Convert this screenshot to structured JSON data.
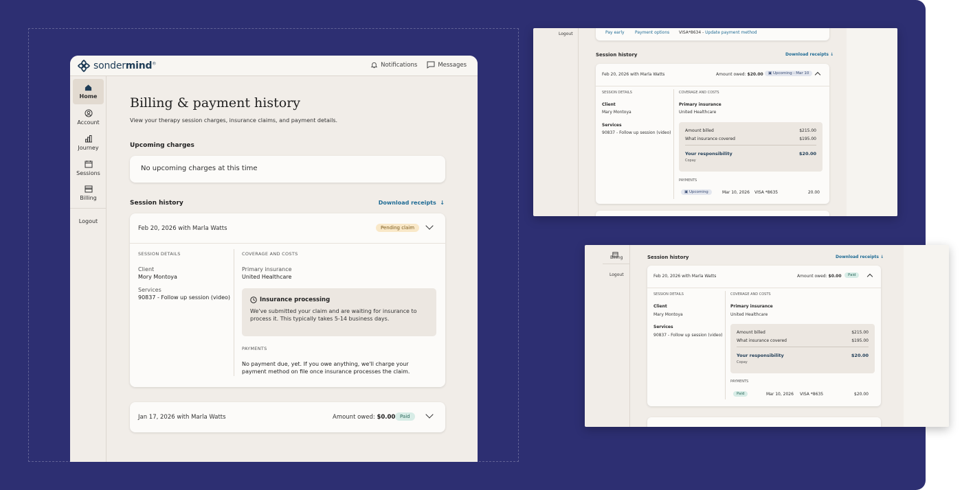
{
  "brand": {
    "name_light": "sonder",
    "name_bold": "mind",
    "mark": "®"
  },
  "topnav": {
    "notifications": "Notifications",
    "messages": "Messages"
  },
  "sidebar": {
    "items": [
      {
        "label": "Home",
        "icon": "home-icon"
      },
      {
        "label": "Account",
        "icon": "account-icon"
      },
      {
        "label": "Journey",
        "icon": "chart-icon"
      },
      {
        "label": "Sessions",
        "icon": "calendar-icon"
      },
      {
        "label": "Billing",
        "icon": "card-icon"
      }
    ],
    "logout": "Logout"
  },
  "page": {
    "title": "Billing & payment history",
    "subtitle": "View your therapy session charges, insurance claims, and payment details.",
    "upcoming_heading": "Upcoming charges",
    "upcoming_empty": "No upcoming charges at this time",
    "history_heading": "Session history",
    "download_receipts": "Download receipts"
  },
  "sessions": [
    {
      "title": "Feb 20, 2026 with Marla Watts",
      "badge": "Pending claim",
      "session_details_label": "SESSION DETAILS",
      "client_label": "Client",
      "client": "Mory Montoya",
      "services_label": "Services",
      "services": "90837 - Follow up session (video)",
      "coverage_label": "COVERAGE AND COSTS",
      "insurance_label": "Primary insurance",
      "insurance": "United Healthcare",
      "info_title": "Insurance processing",
      "info_text": "We've submitted your claim and are waiting for insurance to process it. This typically takes 5-14 business days.",
      "payments_label": "PAYMENTS",
      "payments_text": "No payment due, yet. If you owe anything, we'll charge your payment method on file once insurance processes the claim."
    },
    {
      "title": "Jan 17, 2026 with Marla Watts",
      "owed_label": "Amount owed:",
      "owed": "$0.00",
      "badge": "Paid"
    }
  ],
  "panel1": {
    "logout": "Logout",
    "pay_early": "Pay early",
    "payment_options": "Payment options",
    "visa_prefix": "VISA*8634 - ",
    "update_method": "Update payment method",
    "history_heading": "Session history",
    "download_receipts": "Download receipts",
    "row_title": "Feb 20, 2026 with Marla Watts",
    "owed_label": "Amount owed:",
    "owed": "$20.00",
    "badge": "Upcoming - Mar 10",
    "session_details_label": "SESSION DETAILS",
    "client_label": "Client",
    "client": "Mary Montoya",
    "services_label": "Services",
    "services": "90837 - Follow up session (video)",
    "coverage_label": "COVERAGE AND COSTS",
    "insurance_label": "Primary insurance",
    "insurance": "United Healthcare",
    "amount_billed_label": "Amount billed",
    "amount_billed": "$215.00",
    "covered_label": "What insurance covered",
    "covered": "$195.00",
    "responsibility_label": "Your responsibility",
    "responsibility": "$20.00",
    "copay": "Copay",
    "payments_label": "PAYMENTS",
    "pay_status": "Upcoming",
    "pay_date": "Mar 10, 2026",
    "pay_card": "VISA *8635",
    "pay_amount": "20.00"
  },
  "panel2": {
    "billing": "Billing",
    "logout": "Logout",
    "history_heading": "Session history",
    "download_receipts": "Download receipts",
    "row_title": "Feb 20, 2026 with Marla Watts",
    "owed_label": "Amount owed:",
    "owed": "$0.00",
    "badge": "Paid",
    "session_details_label": "SESSION DETAILS",
    "client_label": "Client",
    "client": "Mary Montoya",
    "services_label": "Services",
    "services": "90837 - Follow up session (video)",
    "coverage_label": "COVERAGE AND COSTS",
    "insurance_label": "Primary insurance",
    "insurance": "United Healthcare",
    "amount_billed_label": "Amount billed",
    "amount_billed": "$215.00",
    "covered_label": "What insurance covered",
    "covered": "$195.00",
    "responsibility_label": "Your responsibility",
    "responsibility": "$20.00",
    "copay": "Copay",
    "payments_label": "PAYMENTS",
    "pay_status": "Paid",
    "pay_date": "Mar 10, 2026",
    "pay_card": "VISA *8635",
    "pay_amount": "$20.00"
  },
  "colors": {
    "background": "#2d2f72",
    "accent_link": "#1f6b94",
    "brand": "#1e3c56",
    "pending_badge": "#f9e8c8",
    "paid_badge": "#d7ece6"
  }
}
